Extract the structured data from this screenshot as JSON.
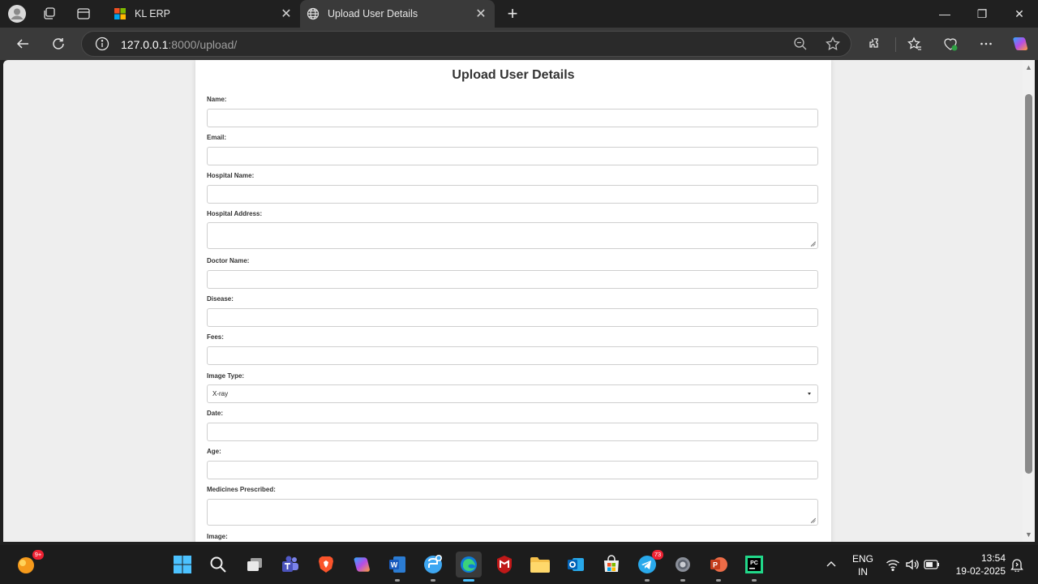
{
  "browser": {
    "tabs": [
      {
        "title": "KL ERP",
        "active": false
      },
      {
        "title": "Upload User Details",
        "active": true
      }
    ],
    "close_glyph": "✕",
    "new_tab_glyph": "+",
    "url_host": "127.0.0.1",
    "url_rest": ":8000/upload/",
    "window_controls": [
      "—",
      "❐",
      "✕"
    ]
  },
  "form": {
    "title": "Upload User Details",
    "fields": [
      {
        "label": "Name:",
        "type": "text",
        "value": ""
      },
      {
        "label": "Email:",
        "type": "text",
        "value": ""
      },
      {
        "label": "Hospital Name:",
        "type": "text",
        "value": ""
      },
      {
        "label": "Hospital Address:",
        "type": "textarea",
        "value": ""
      },
      {
        "label": "Doctor Name:",
        "type": "text",
        "value": ""
      },
      {
        "label": "Disease:",
        "type": "text",
        "value": ""
      },
      {
        "label": "Fees:",
        "type": "text",
        "value": ""
      },
      {
        "label": "Image Type:",
        "type": "select",
        "value": "X-ray"
      },
      {
        "label": "Date:",
        "type": "text",
        "value": ""
      },
      {
        "label": "Age:",
        "type": "text",
        "value": ""
      },
      {
        "label": "Medicines Prescribed:",
        "type": "textarea",
        "value": ""
      },
      {
        "label": "Image:",
        "type": "file",
        "value": ""
      }
    ]
  },
  "taskbar": {
    "widget_badge": "9+",
    "telegram_badge": "73",
    "lang_top": "ENG",
    "lang_bottom": "IN",
    "time": "13:54",
    "date": "19-02-2025"
  },
  "colors": {
    "accent": "#4cc2ff",
    "page_bg": "#eeeeee",
    "card_bg": "#ffffff"
  }
}
